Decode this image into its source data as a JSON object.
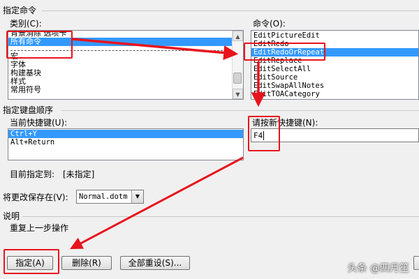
{
  "specify_command": {
    "group_title": "指定命令",
    "categories_label": "类别(C):",
    "categories": [
      "背景消除 选项卡",
      "所有命令",
      "宏",
      "字体",
      "构建基块",
      "样式",
      "常用符号"
    ],
    "commands_label": "命令(O):",
    "commands": [
      "EditPictureEdit",
      "EditRedo",
      "EditRedoOrRepeat",
      "EditReplace",
      "EditSelectAll",
      "EditSource",
      "EditSwapAllNotes",
      "EditTOACategory"
    ]
  },
  "keyboard_sequence": {
    "group_title": "指定键盘顺序",
    "current_keys_label": "当前快捷键(U):",
    "current_keys": [
      "Ctrl+Y",
      "Alt+Return"
    ],
    "new_key_label": "请按新快捷键(N):",
    "new_key_value": "F4"
  },
  "assigned_to": {
    "label": "目前指定到:",
    "value": "[未指定]"
  },
  "save_changes": {
    "label": "将更改保存在(V):",
    "value": "Normal.dotm"
  },
  "description": {
    "title": "说明",
    "text": "重复上一步操作"
  },
  "buttons": {
    "assign": "指定(A)",
    "remove": "删除(R)",
    "reset_all": "全部重设(S)..."
  },
  "watermark": "头条 @四月笙",
  "colors": {
    "selection": "#3399ff",
    "annotation": "#e8141c"
  }
}
